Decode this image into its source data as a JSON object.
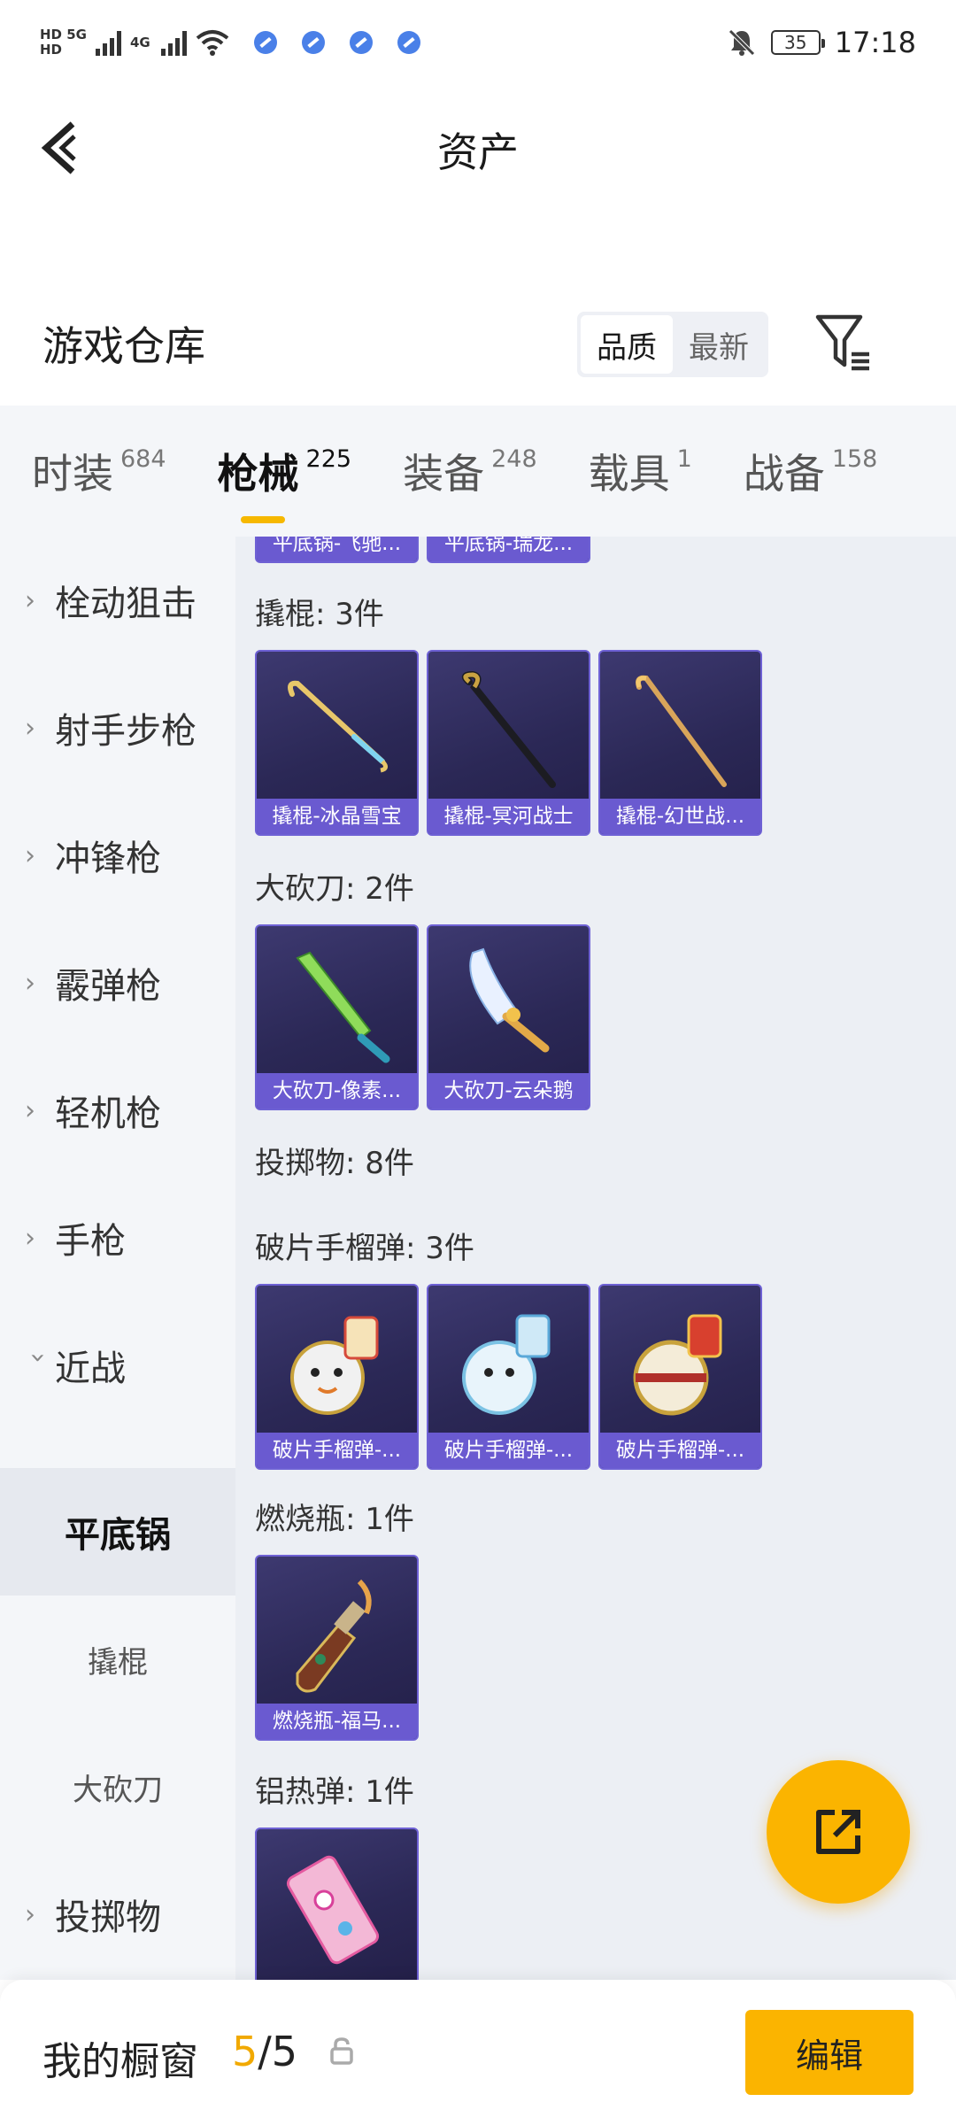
{
  "status_bar": {
    "net_top": "HD 5G",
    "net_bottom": "HD",
    "gen_label": "4G",
    "battery": "35",
    "time": "17:18"
  },
  "header": {
    "title": "资产"
  },
  "warehouse": {
    "title": "游戏仓库",
    "sort_options": [
      "品质",
      "最新"
    ],
    "active_sort": "品质"
  },
  "tabs": [
    {
      "label": "时装",
      "count": "684"
    },
    {
      "label": "枪械",
      "count": "225"
    },
    {
      "label": "装备",
      "count": "248"
    },
    {
      "label": "载具",
      "count": "1"
    },
    {
      "label": "战备",
      "count": "158"
    }
  ],
  "active_tab": "枪械",
  "sidebar": {
    "categories": [
      "栓动狙击",
      "射手步枪",
      "冲锋枪",
      "霰弹枪",
      "轻机枪",
      "手枪",
      "近战"
    ],
    "expanded": "近战",
    "subcategories": [
      "平底锅",
      "撬棍",
      "大砍刀"
    ],
    "active_sub": "平底锅",
    "after": "投掷物"
  },
  "content": {
    "partial_items": [
      "平底锅-飞驰...",
      "平底锅-瑞龙..."
    ],
    "sections": [
      {
        "label": "撬棍: 3件",
        "items": [
          "撬棍-冰晶雪宝",
          "撬棍-冥河战士",
          "撬棍-幻世战..."
        ]
      },
      {
        "label": "大砍刀: 2件",
        "items": [
          "大砍刀-像素...",
          "大砍刀-云朵鹅"
        ]
      },
      {
        "label": "投掷物: 8件",
        "items": []
      },
      {
        "label": "破片手榴弹: 3件",
        "items": [
          "破片手榴弹-...",
          "破片手榴弹-...",
          "破片手榴弹-..."
        ]
      },
      {
        "label": "燃烧瓶: 1件",
        "items": [
          "燃烧瓶-福马..."
        ]
      },
      {
        "label": "铝热弹: 1件",
        "items": []
      }
    ]
  },
  "bottom_bar": {
    "label": "我的橱窗",
    "current": "5",
    "separator": "/",
    "total": "5",
    "edit_label": "编辑"
  },
  "colors": {
    "accent": "#fbb400",
    "card_border": "#6e61d4",
    "card_name_bg": "#6a5ad0"
  }
}
